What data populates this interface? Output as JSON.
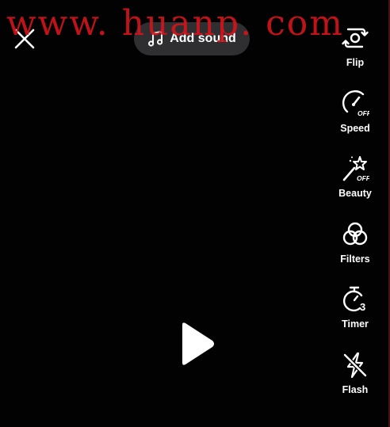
{
  "watermark": {
    "text": "www. huanp. com",
    "color": "#d1141b"
  },
  "top_bar": {
    "close_icon": "close-icon",
    "add_sound": {
      "icon": "music-note-icon",
      "label": "Add sound"
    }
  },
  "side_tools": [
    {
      "id": "flip",
      "label": "Flip",
      "icon": "flip-camera-icon"
    },
    {
      "id": "speed",
      "label": "Speed",
      "icon": "speed-gauge-icon",
      "state_text": "OFF"
    },
    {
      "id": "beauty",
      "label": "Beauty",
      "icon": "magic-wand-icon",
      "state_text": "OFF"
    },
    {
      "id": "filters",
      "label": "Filters",
      "icon": "filters-circles-icon"
    },
    {
      "id": "timer",
      "label": "Timer",
      "icon": "timer-icon",
      "state_text": "3"
    },
    {
      "id": "flash",
      "label": "Flash",
      "icon": "flash-off-icon"
    }
  ],
  "player": {
    "play_icon": "play-icon"
  },
  "colors": {
    "background": "#030202",
    "foreground": "#ffffff",
    "pill_background": "#3c3c40",
    "watermark": "#d1141b"
  }
}
